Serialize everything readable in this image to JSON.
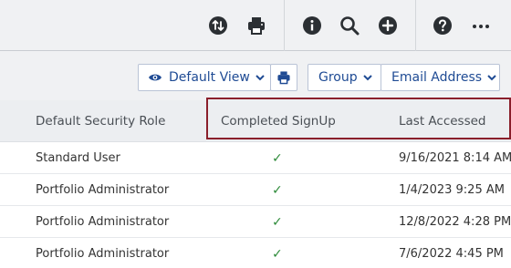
{
  "toolbar": {
    "icons": [
      "sync-icon",
      "print-icon",
      "info-icon",
      "search-icon",
      "add-icon",
      "help-icon",
      "more-icon"
    ]
  },
  "viewbar": {
    "default_view_label": "Default View",
    "group_label": "Group",
    "email_label": "Email Address"
  },
  "table": {
    "columns": [
      "Default Security Role",
      "Completed SignUp",
      "Last Accessed"
    ],
    "rows": [
      {
        "role": "Standard User",
        "completed": "✓",
        "last_accessed": "9/16/2021 8:14 AM"
      },
      {
        "role": "Portfolio Administrator",
        "completed": "✓",
        "last_accessed": "1/4/2023 9:25 AM"
      },
      {
        "role": "Portfolio Administrator",
        "completed": "✓",
        "last_accessed": "12/8/2022 4:28 PM"
      },
      {
        "role": "Portfolio Administrator",
        "completed": "✓",
        "last_accessed": "7/6/2022 4:45 PM"
      }
    ]
  },
  "colors": {
    "accent": "#1f4b94",
    "highlight_border": "#8a1f2b",
    "check": "#2e8b3a"
  }
}
